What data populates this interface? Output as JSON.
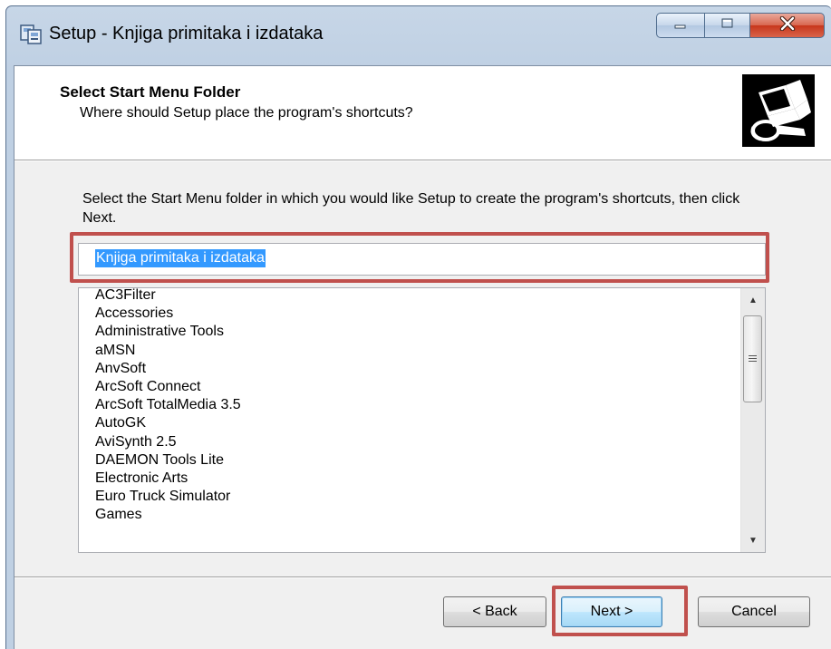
{
  "window": {
    "title": "Setup - Knjiga primitaka i izdataka",
    "icon": "setup-icon",
    "caption_buttons": {
      "minimize_icon": "minimize-icon",
      "maximize_icon": "maximize-icon",
      "close_icon": "close-icon"
    }
  },
  "header": {
    "title": "Select Start Menu Folder",
    "subtitle": "Where should Setup place the program's shortcuts?",
    "icon": "computer-install-icon"
  },
  "body": {
    "instruction": "Select the Start Menu folder in which you would like Setup to create the program's shortcuts, then click Next.",
    "folder_input": {
      "value": "Knjiga primitaka i izdataka",
      "selected": true
    },
    "folder_list": [
      "AC3Filter",
      "Accessories",
      "Administrative Tools",
      "aMSN",
      "AnvSoft",
      "ArcSoft Connect",
      "ArcSoft TotalMedia 3.5",
      "AutoGK",
      "AviSynth 2.5",
      "DAEMON Tools Lite",
      "Electronic Arts",
      "Euro Truck Simulator",
      "Games"
    ]
  },
  "buttons": {
    "back": "< Back",
    "next": "Next >",
    "cancel": "Cancel"
  },
  "colors": {
    "highlight_border": "#c0504d",
    "selection": "#3399ff",
    "dialog_bg": "#f0f0f0"
  }
}
